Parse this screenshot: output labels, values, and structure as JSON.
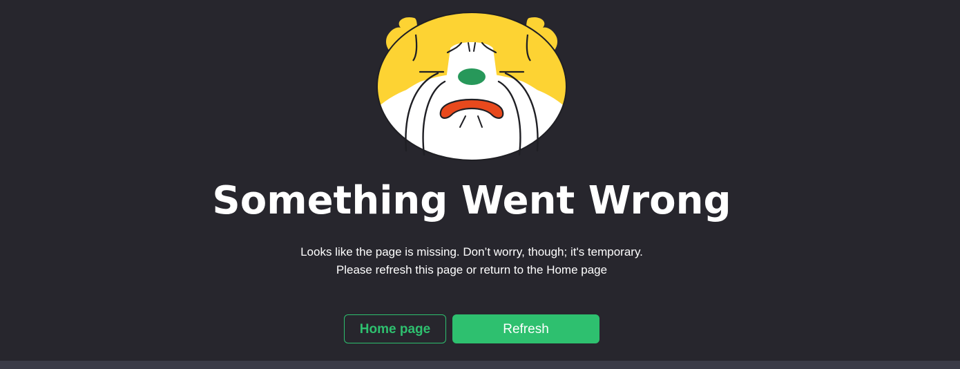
{
  "error": {
    "title": "Something Went Wrong",
    "message_line1": "Looks like the page is missing. Don’t worry, though; it's temporary.",
    "message_line2": "Please refresh this page or return to the Home page"
  },
  "actions": {
    "home_label": "Home page",
    "refresh_label": "Refresh"
  },
  "illustration": {
    "name": "sad-dog-icon",
    "colors": {
      "fur": "#fdd333",
      "face": "#ffffff",
      "nose": "#27985a",
      "mouth": "#e8491d",
      "outline": "#1f1f24"
    }
  },
  "theme": {
    "background": "#27262d",
    "accent": "#2ec06f",
    "footer": "#3a3b47"
  }
}
